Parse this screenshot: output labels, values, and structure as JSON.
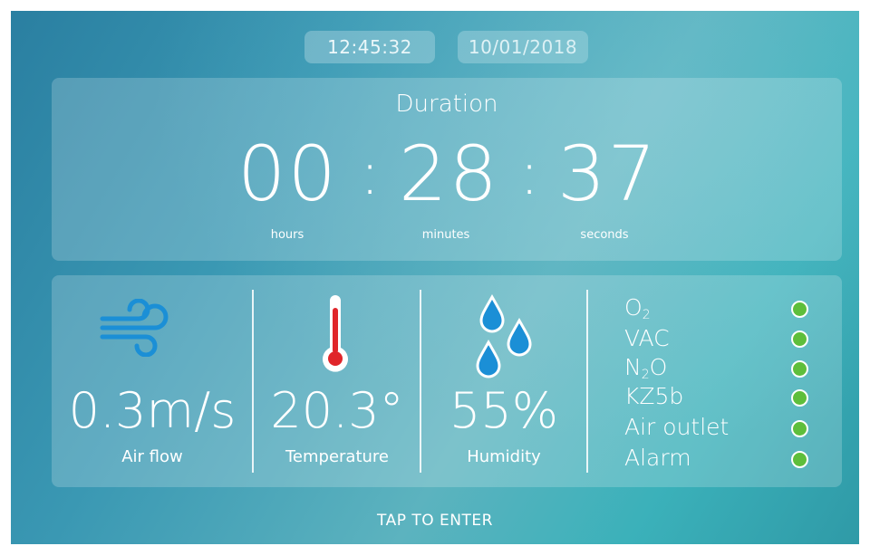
{
  "header": {
    "time": "12:45:32",
    "date": "10/01/2018"
  },
  "duration": {
    "title": "Duration",
    "hours": "00",
    "minutes": "28",
    "seconds": "37",
    "separator": ":",
    "hours_label": "hours",
    "minutes_label": "minutes",
    "seconds_label": "seconds"
  },
  "sensors": {
    "airflow": {
      "value": "0.3m/s",
      "label": "Air flow",
      "icon": "wind-icon"
    },
    "temperature": {
      "value": "20.3°",
      "label": "Temperature",
      "icon": "thermometer-icon"
    },
    "humidity": {
      "value": "55%",
      "label": "Humidity",
      "icon": "water-drops-icon"
    }
  },
  "gases": [
    {
      "name": "O",
      "sub": "2",
      "status": "ok"
    },
    {
      "name": "VAC",
      "sub": "",
      "status": "ok"
    },
    {
      "name": "N",
      "sub": "2",
      "suffix": "O",
      "status": "ok"
    },
    {
      "name": "KZ5b",
      "sub": "",
      "status": "ok"
    },
    {
      "name": "Air outlet",
      "sub": "",
      "status": "ok"
    },
    {
      "name": "Alarm",
      "sub": "",
      "status": "ok"
    }
  ],
  "colors": {
    "status_ok": "#5ebe3b",
    "icon_blue": "#1b8fd6",
    "thermometer_red": "#e0252a"
  },
  "footer": {
    "cta": "TAP TO ENTER"
  }
}
